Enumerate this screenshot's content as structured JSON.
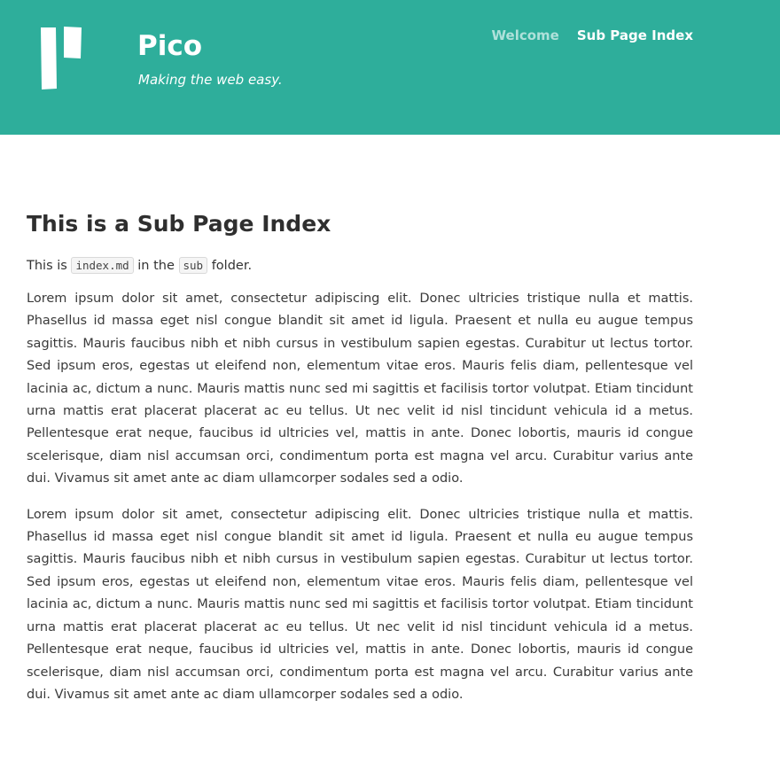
{
  "header": {
    "site_title": "Pico",
    "tagline": "Making the web easy.",
    "logo_icon": "pico-logo-icon",
    "background_color": "#2eae9b"
  },
  "nav": {
    "items": [
      {
        "label": "Welcome"
      },
      {
        "label": "Sub Page Index"
      }
    ]
  },
  "main": {
    "title": "This is a Sub Page Index",
    "intro": {
      "prefix": "This is",
      "code1": "index.md",
      "middle": "in the",
      "code2": "sub",
      "suffix": "folder."
    },
    "paragraphs": [
      "Lorem ipsum dolor sit amet, consectetur adipiscing elit. Donec ultricies tristique nulla et mattis. Phasellus id massa eget nisl congue blandit sit amet id ligula. Praesent et nulla eu augue tempus sagittis. Mauris faucibus nibh et nibh cursus in vestibulum sapien egestas. Curabitur ut lectus tortor. Sed ipsum eros, egestas ut eleifend non, elementum vitae eros. Mauris felis diam, pellentesque vel lacinia ac, dictum a nunc. Mauris mattis nunc sed mi sagittis et facilisis tortor volutpat. Etiam tincidunt urna mattis erat placerat placerat ac eu tellus. Ut nec velit id nisl tincidunt vehicula id a metus. Pellentesque erat neque, faucibus id ultricies vel, mattis in ante. Donec lobortis, mauris id congue scelerisque, diam nisl accumsan orci, condimentum porta est magna vel arcu. Curabitur varius ante dui. Vivamus sit amet ante ac diam ullamcorper sodales sed a odio.",
      "Lorem ipsum dolor sit amet, consectetur adipiscing elit. Donec ultricies tristique nulla et mattis. Phasellus id massa eget nisl congue blandit sit amet id ligula. Praesent et nulla eu augue tempus sagittis. Mauris faucibus nibh et nibh cursus in vestibulum sapien egestas. Curabitur ut lectus tortor. Sed ipsum eros, egestas ut eleifend non, elementum vitae eros. Mauris felis diam, pellentesque vel lacinia ac, dictum a nunc. Mauris mattis nunc sed mi sagittis et facilisis tortor volutpat. Etiam tincidunt urna mattis erat placerat placerat ac eu tellus. Ut nec velit id nisl tincidunt vehicula id a metus. Pellentesque erat neque, faucibus id ultricies vel, mattis in ante. Donec lobortis, mauris id congue scelerisque, diam nisl accumsan orci, condimentum porta est magna vel arcu. Curabitur varius ante dui. Vivamus sit amet ante ac diam ullamcorper sodales sed a odio."
    ]
  }
}
